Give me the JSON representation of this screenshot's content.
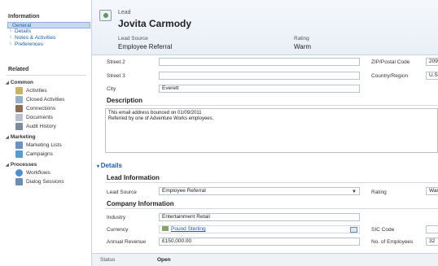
{
  "nav": {
    "information_title": "Information",
    "information_items": [
      {
        "label": "General"
      },
      {
        "label": "Details"
      },
      {
        "label": "Notes & Activities"
      },
      {
        "label": "Preferences"
      }
    ],
    "related_title": "Related",
    "groups": [
      {
        "label": "Common",
        "items": [
          {
            "label": "Activities"
          },
          {
            "label": "Closed Activities"
          },
          {
            "label": "Connections"
          },
          {
            "label": "Documents"
          },
          {
            "label": "Audit History"
          }
        ]
      },
      {
        "label": "Marketing",
        "items": [
          {
            "label": "Marketing Lists"
          },
          {
            "label": "Campaigns"
          }
        ]
      },
      {
        "label": "Processes",
        "items": [
          {
            "label": "Workflows"
          },
          {
            "label": "Dialog Sessions"
          }
        ]
      }
    ]
  },
  "header": {
    "entity": "Lead",
    "name": "Jovita Carmody",
    "lead_source_label": "Lead Source",
    "lead_source_value": "Employee Referral",
    "rating_label": "Rating",
    "rating_value": "Warm"
  },
  "address": {
    "street2_label": "Street 2",
    "street2_value": "",
    "street3_label": "Street 3",
    "street3_value": "",
    "city_label": "City",
    "city_value": "Everett",
    "zip_label": "ZIP/Postal Code",
    "zip_value": "2095",
    "country_label": "Country/Region",
    "country_value": "U.S."
  },
  "description": {
    "title": "Description",
    "text_line1": "This email address bounced on 01/09/2011",
    "text_line2": "Referred by one of Adventure Works employees."
  },
  "details": {
    "title": "Details",
    "lead_info_title": "Lead Information",
    "lead_source_label": "Lead Source",
    "lead_source_value": "Employee Referral",
    "rating_label": "Rating",
    "rating_value": "War",
    "company_info_title": "Company Information",
    "industry_label": "Industry",
    "industry_value": "Entertainment Retail",
    "currency_label": "Currency",
    "currency_value": "Pound Sterling",
    "sic_label": "SIC Code",
    "sic_value": "",
    "revenue_label": "Annual Revenue",
    "revenue_value": "£150,000.00",
    "employees_label": "No. of Employees",
    "employees_value": "32"
  },
  "status": {
    "label": "Status",
    "value": "Open"
  },
  "colors": {
    "link": "#1e5ba8",
    "selected_bg": "#c7d9f0"
  }
}
